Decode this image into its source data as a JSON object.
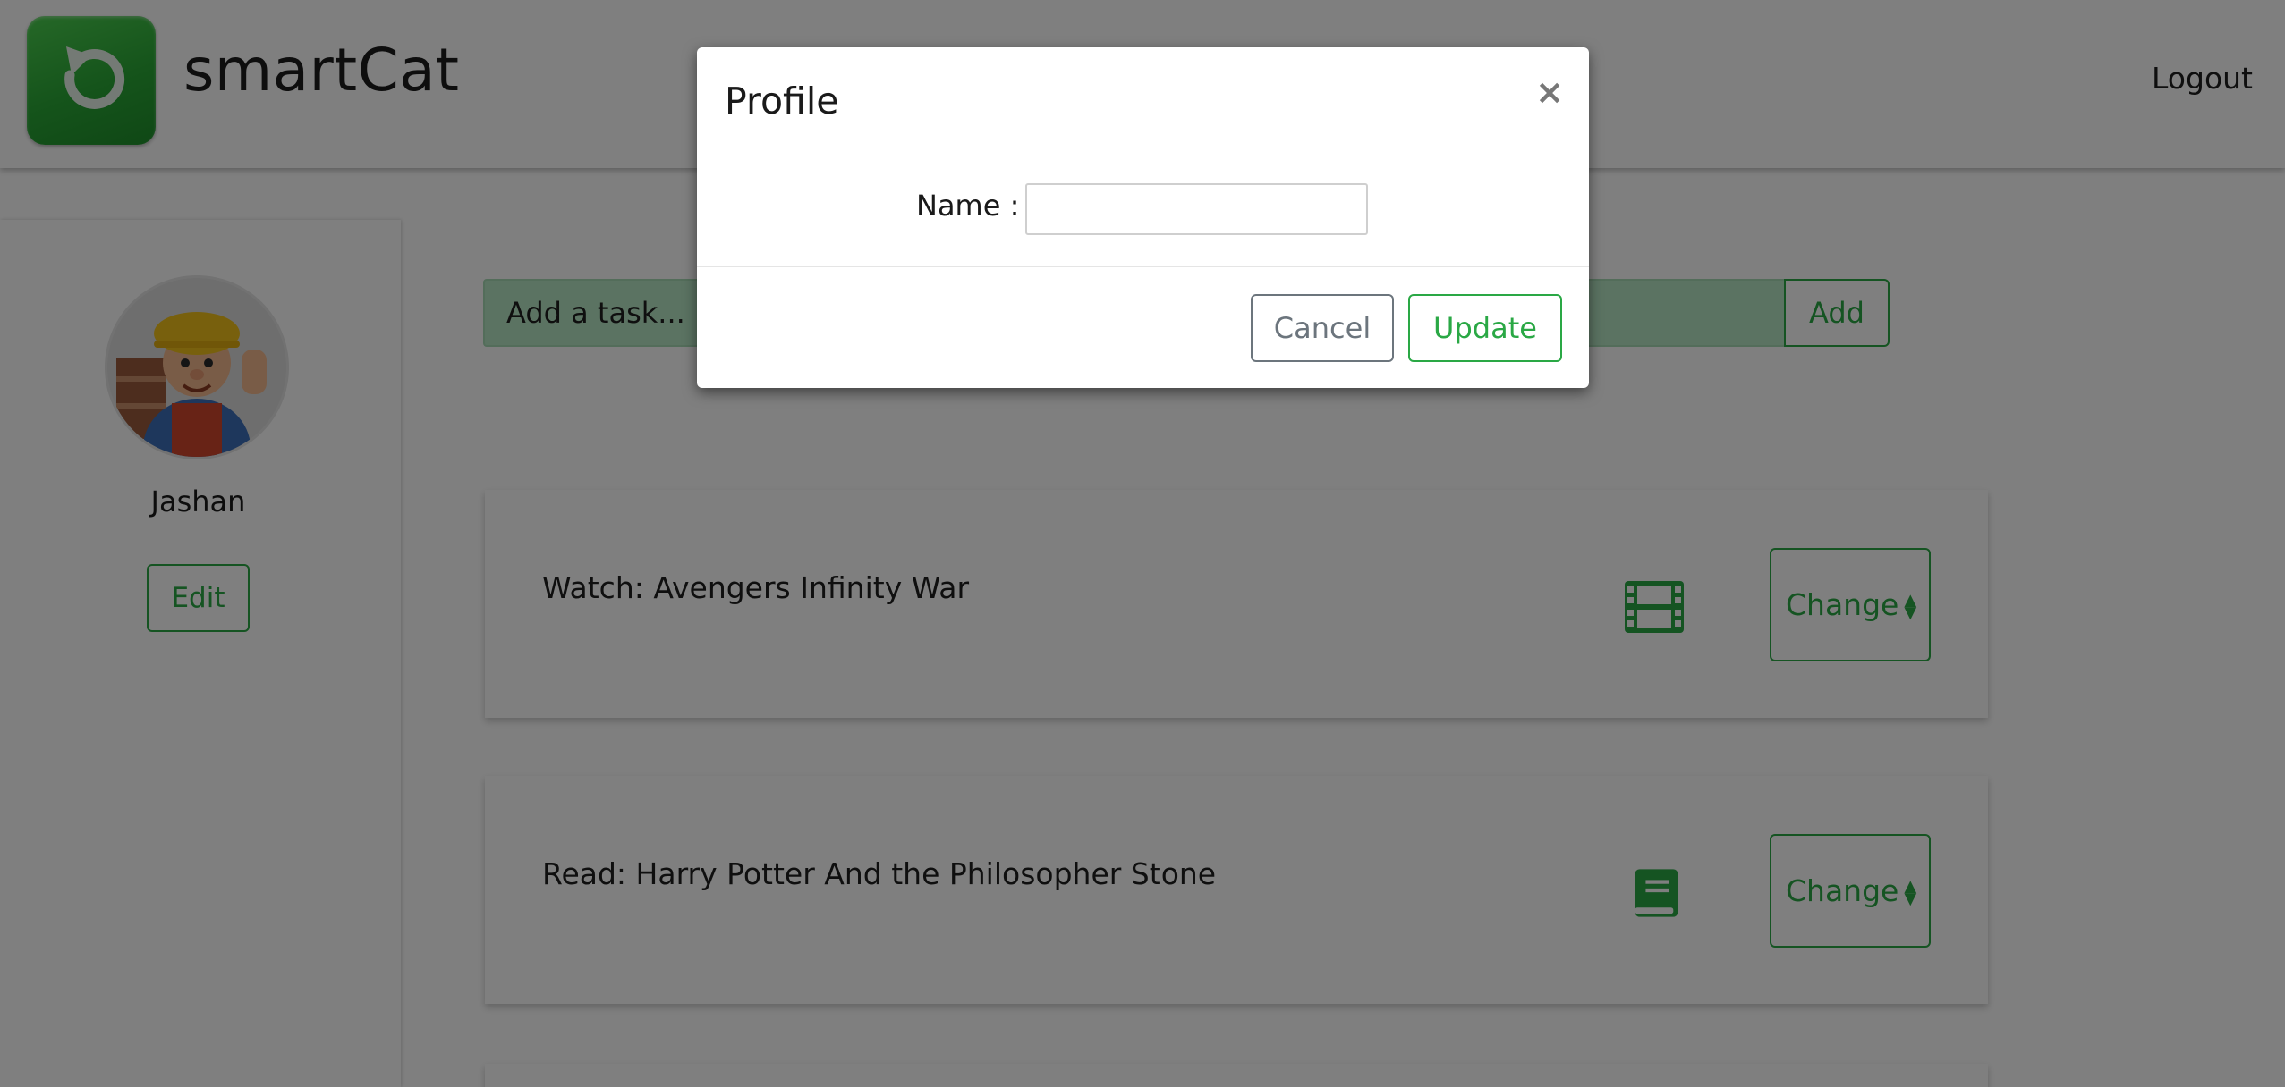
{
  "header": {
    "brand": "smartCat",
    "logo_icon": "refresh-arrow-icon",
    "logout_label": "Logout"
  },
  "sidebar": {
    "avatar_icon": "user-avatar",
    "username": "Jashan",
    "edit_label": "Edit"
  },
  "task_form": {
    "placeholder": "Add a task...",
    "add_label": "Add"
  },
  "tasks": [
    {
      "title": "Watch: Avengers Infinity War",
      "category_icon": "film-icon",
      "change_label": "Change"
    },
    {
      "title": "Read: Harry Potter And the Philosopher Stone",
      "category_icon": "book-icon",
      "change_label": "Change"
    }
  ],
  "modal": {
    "title": "Profile",
    "close_glyph": "×",
    "name_label": "Name :",
    "name_value": "",
    "cancel_label": "Cancel",
    "update_label": "Update"
  },
  "colors": {
    "accent": "#2aa845",
    "input_bg": "#b7e6c4",
    "backdrop": "rgba(0,0,0,0.5)"
  }
}
